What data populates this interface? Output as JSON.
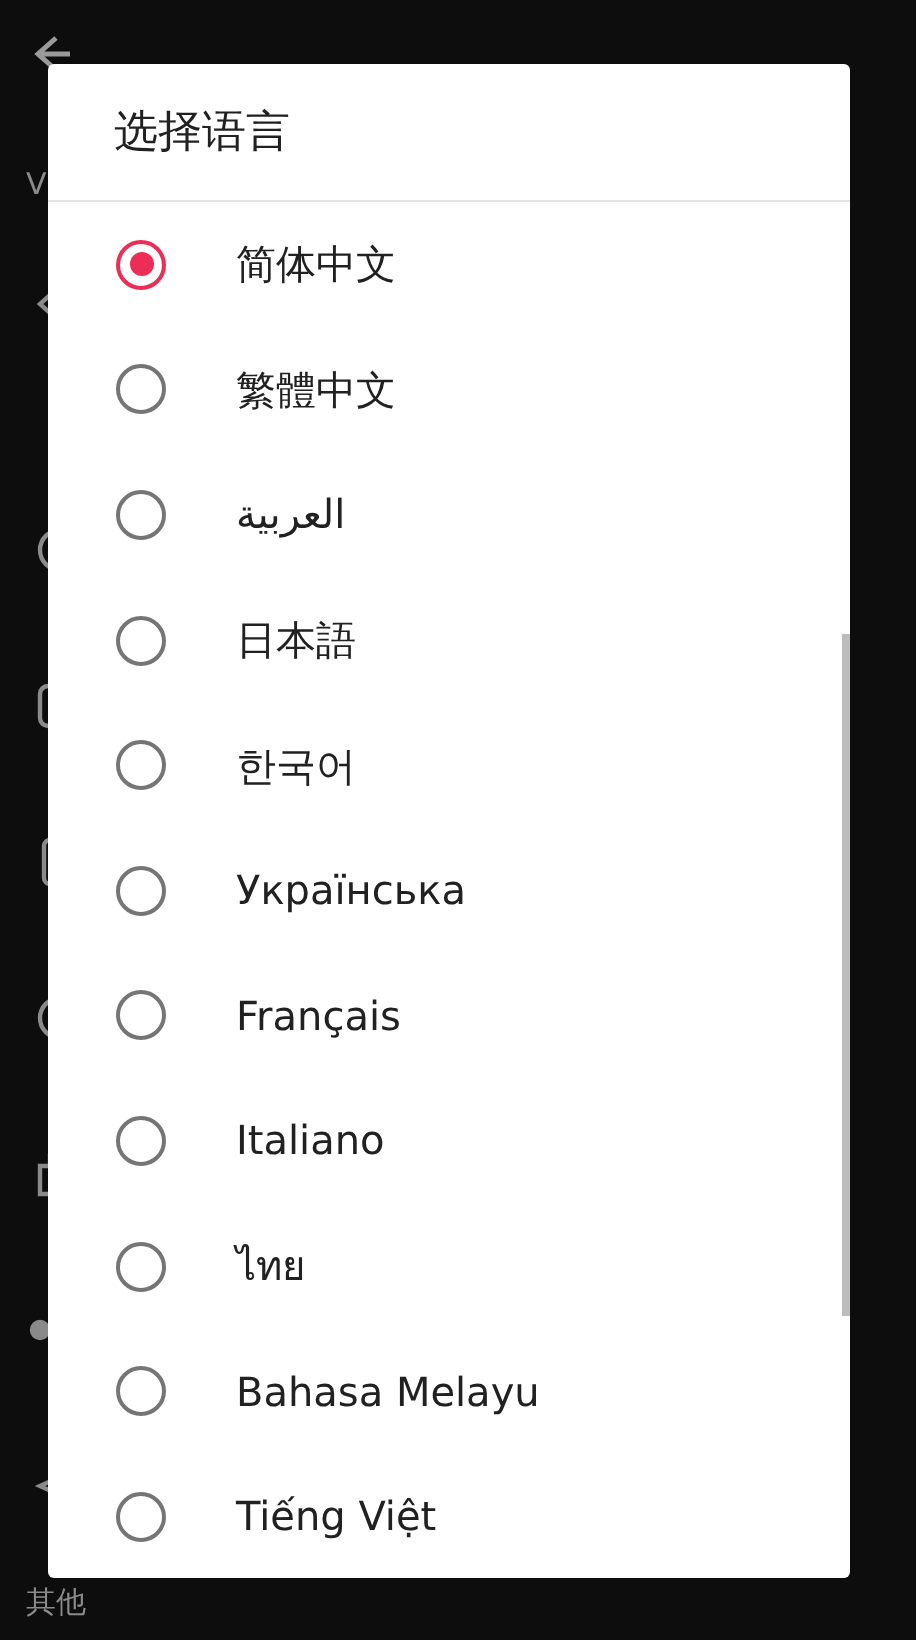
{
  "settings_page": {
    "items": [
      {
        "kind": "label",
        "text": "V"
      },
      {
        "kind": "row"
      },
      {
        "kind": "row"
      },
      {
        "kind": "row"
      },
      {
        "kind": "row"
      },
      {
        "kind": "row"
      },
      {
        "kind": "row"
      },
      {
        "kind": "row"
      },
      {
        "kind": "row"
      },
      {
        "kind": "label",
        "text": "其他"
      }
    ]
  },
  "dialog": {
    "title": "选择语言",
    "options": [
      {
        "label": "简体中文",
        "selected": true
      },
      {
        "label": "繁體中文",
        "selected": false
      },
      {
        "label": "العربية",
        "selected": false
      },
      {
        "label": "日本語",
        "selected": false
      },
      {
        "label": "한국어",
        "selected": false
      },
      {
        "label": "Українська",
        "selected": false
      },
      {
        "label": "Français",
        "selected": false
      },
      {
        "label": "Italiano",
        "selected": false
      },
      {
        "label": "ไทย",
        "selected": false
      },
      {
        "label": "Bahasa Melayu",
        "selected": false
      },
      {
        "label": "Tiếng Việt",
        "selected": false
      }
    ]
  }
}
